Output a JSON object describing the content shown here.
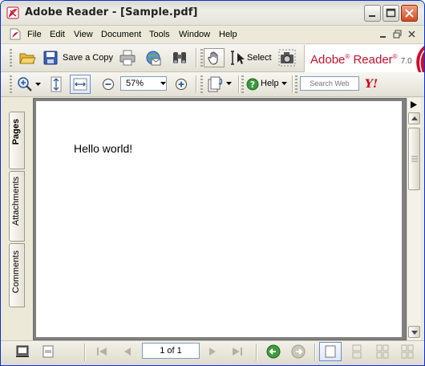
{
  "window": {
    "title": "Adobe Reader - [Sample.pdf]"
  },
  "menu": {
    "items": [
      "File",
      "Edit",
      "View",
      "Document",
      "Tools",
      "Window",
      "Help"
    ]
  },
  "toolbar1": {
    "save_copy_label": "Save a Copy",
    "select_label": "Select",
    "brand_name": "Adobe",
    "brand_product": "Reader",
    "brand_version": "7.0"
  },
  "toolbar2": {
    "zoom_value": "57%",
    "help_label": "Help",
    "search_placeholder": "Search Web"
  },
  "sidetabs": [
    "Pages",
    "Attachments",
    "Comments"
  ],
  "document": {
    "text": "Hello world!"
  },
  "status": {
    "page_indicator": "1 of 1"
  },
  "colors": {
    "brand_red": "#c8102e",
    "xp_blue": "#0831d9"
  }
}
